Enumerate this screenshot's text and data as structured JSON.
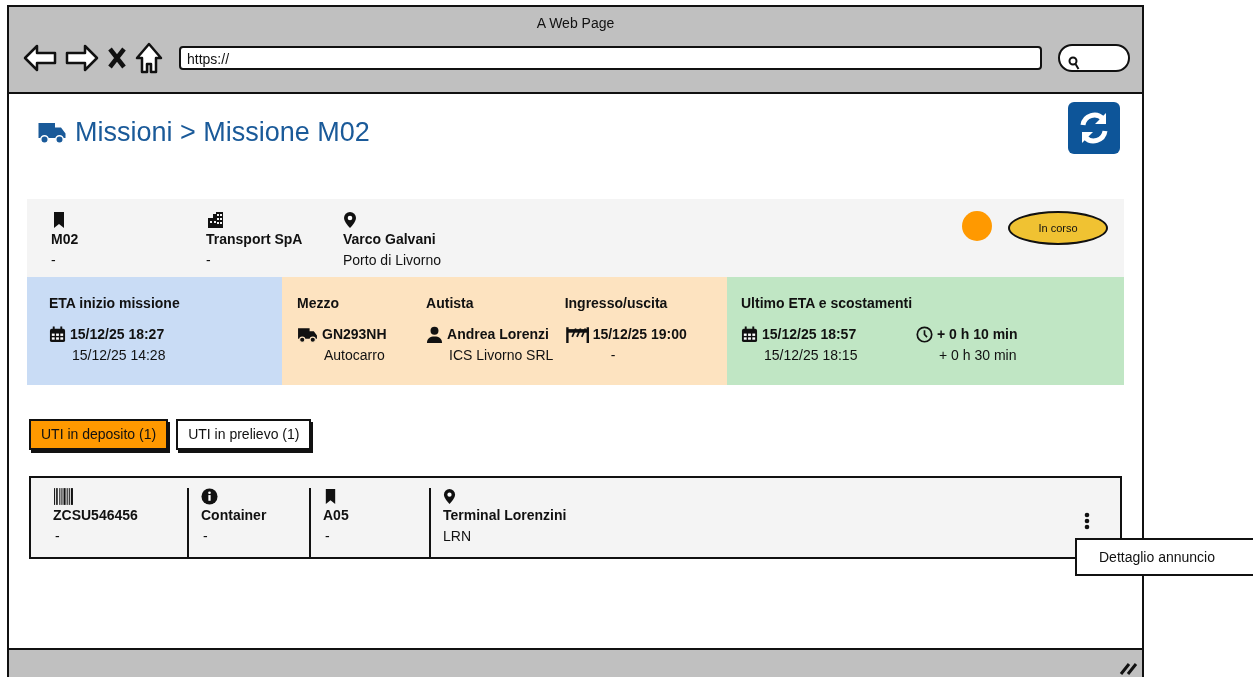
{
  "window": {
    "title": "A Web Page",
    "url": "https://"
  },
  "header": {
    "title": "Missioni > Missione M02"
  },
  "summary": {
    "fields": [
      {
        "kind": "bookmark",
        "value": "M02",
        "sub": "-"
      },
      {
        "kind": "building",
        "value": "Transport SpA",
        "sub": "-"
      },
      {
        "kind": "pin",
        "value": "Varco Galvani",
        "sub": "Porto di Livorno"
      }
    ],
    "status": {
      "label": "In corso",
      "color": "#ff9900"
    }
  },
  "panels": [
    {
      "color": "#c9dcf5",
      "title": "ETA inizio missione",
      "groups": [
        {
          "kind": "calendar",
          "value": "15/12/25 18:27",
          "sub": "15/12/25 14:28"
        }
      ]
    },
    {
      "color": "#fde3c0",
      "groups": [
        {
          "title": "Mezzo",
          "kind": "truck",
          "value": "GN293NH",
          "sub": "Autocarro"
        },
        {
          "title": "Autista",
          "kind": "person",
          "value": "Andrea Lorenzi",
          "sub": "ICS Livorno SRL"
        },
        {
          "title": "Ingresso/uscita",
          "kind": "gate",
          "value": "15/12/25 19:00",
          "sub": "-"
        }
      ]
    },
    {
      "color": "#c0e6c4",
      "title": "Ultimo ETA e scostamenti",
      "groups": [
        {
          "kind": "calendar",
          "value": "15/12/25  18:57",
          "sub": "15/12/25 18:15"
        },
        {
          "kind": "clock",
          "value": "+ 0 h 10 min",
          "sub": "+ 0 h 30 min"
        }
      ]
    }
  ],
  "tabs": [
    {
      "label": "UTI in deposito (1)",
      "selected": true
    },
    {
      "label": "UTI in prelievo (1)",
      "selected": false
    }
  ],
  "units": [
    {
      "fields": [
        {
          "kind": "barcode",
          "value": "ZCSU546456",
          "sub": "-"
        },
        {
          "kind": "info",
          "value": "Container",
          "sub": "-"
        },
        {
          "kind": "bookmark",
          "value": "A05",
          "sub": "-"
        },
        {
          "kind": "pin",
          "value": "Terminal Lorenzini",
          "sub": "LRN"
        }
      ],
      "menu": [
        "Dettaglio annuncio"
      ]
    }
  ]
}
